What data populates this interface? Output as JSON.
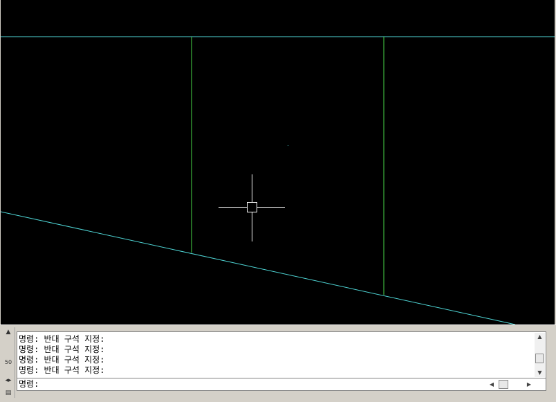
{
  "command_window": {
    "history_lines": [
      "명령: 반대 구석 지정:",
      "명령: 반대 구석 지정:",
      "명령: 반대 구석 지정:",
      "명령: 반대 구석 지정:"
    ],
    "prompt": "명령:",
    "side_label": "50"
  },
  "icons": {
    "pin": "pin-icon",
    "resize": "resize-arrows-icon",
    "menu": "properties-icon"
  },
  "colors": {
    "canvas_bg": "#000000",
    "cyan_line": "#4fd6d6",
    "green_line": "#49d849",
    "crosshair": "#ffffff"
  }
}
